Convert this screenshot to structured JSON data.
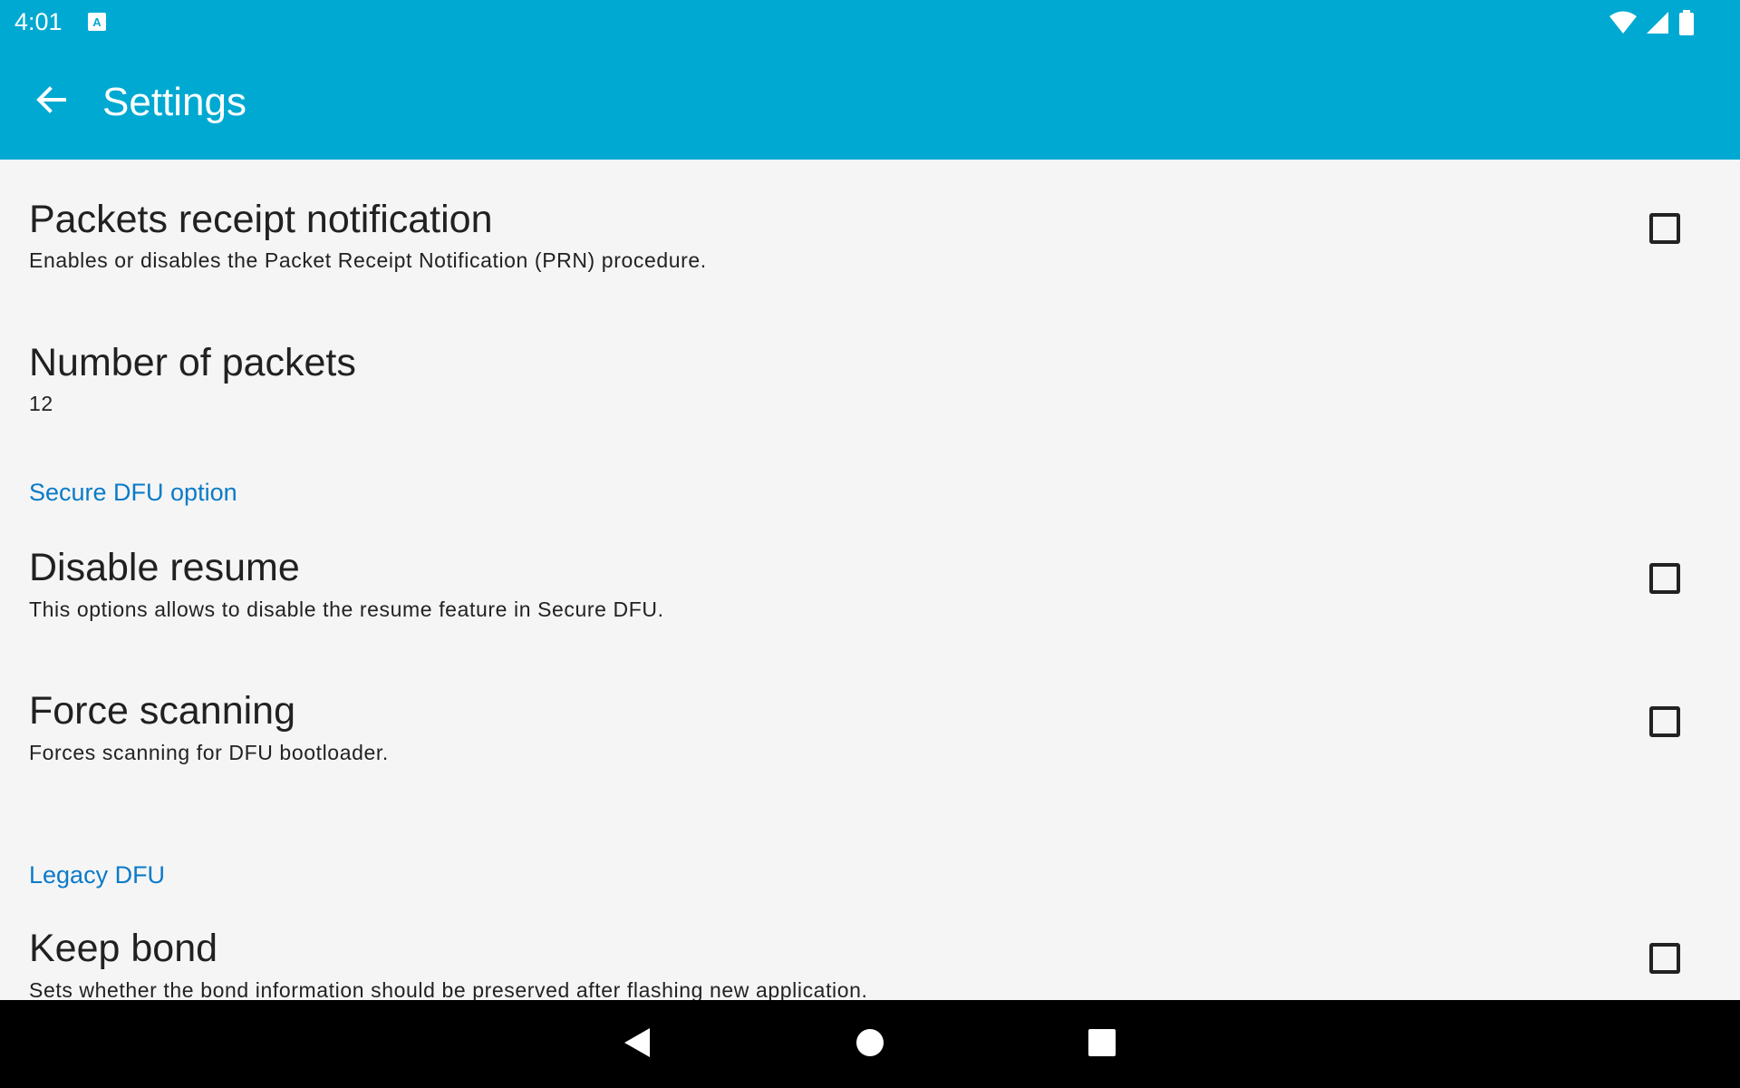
{
  "status_bar": {
    "time": "4:01",
    "icons": [
      "a11y-app-icon",
      "wifi-icon",
      "cell-signal-icon",
      "battery-icon"
    ]
  },
  "app_bar": {
    "title": "Settings",
    "back_icon": "arrow-back-icon"
  },
  "preferences": [
    {
      "type": "checkbox",
      "title": "Packets receipt notification",
      "summary": "Enables or disables the Packet Receipt Notification (PRN) procedure.",
      "checked": false
    },
    {
      "type": "value",
      "title": "Number of packets",
      "summary": "12"
    },
    {
      "type": "category",
      "title": "Secure DFU option"
    },
    {
      "type": "checkbox",
      "title": "Disable resume",
      "summary": "This options allows to disable the resume feature in Secure DFU.",
      "checked": false
    },
    {
      "type": "checkbox",
      "title": "Force scanning",
      "summary": "Forces scanning for DFU bootloader.",
      "checked": false
    },
    {
      "type": "category",
      "title": "Legacy DFU"
    },
    {
      "type": "checkbox",
      "title": "Keep bond",
      "summary": "Sets whether the bond information should be preserved after flashing new application.",
      "checked": false
    }
  ],
  "nav_bar": {
    "icons": [
      "nav-back-icon",
      "nav-home-icon",
      "nav-recents-icon"
    ]
  },
  "colors": {
    "primary": "#00a9d1",
    "background": "#f5f5f5",
    "category_accent": "#0a7bc8",
    "nav_bar": "#000000"
  }
}
